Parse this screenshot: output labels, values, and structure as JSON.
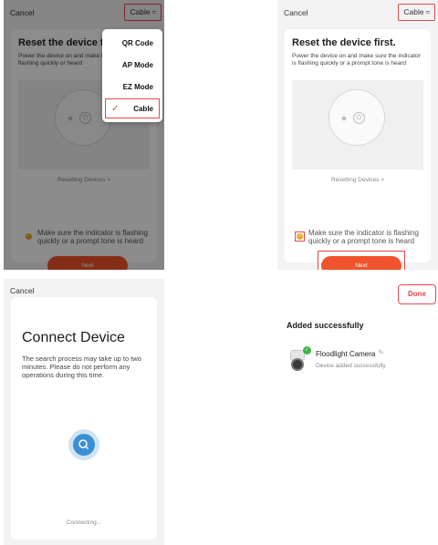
{
  "topbar": {
    "cancel_label": "Cancel",
    "cable_label": "Cable",
    "cable_icon": "≈"
  },
  "reset": {
    "title": "Reset the device first.",
    "title_truncated": "Reset the device firs",
    "description": "Power the device on and make sure the indicator is flashing quickly or a prompt tone is heard",
    "description_truncated": "Power the device on and make indicator is flashing quickly or heard",
    "resetting_link": "Resetting Devices",
    "resetting_chevron": ">",
    "checkbox_text": "Make sure the indicator is flashing quickly or a prompt tone is heard",
    "next_label": "Next"
  },
  "mode_menu": {
    "items": [
      {
        "label": "QR Code"
      },
      {
        "label": "AP Mode"
      },
      {
        "label": "EZ Mode"
      },
      {
        "label": "Cable",
        "selected": true
      }
    ],
    "tick_icon": "✓"
  },
  "connect": {
    "cancel_label": "Cancel",
    "title": "Connect Device",
    "description": "The search process may take up to two minutes. Please do not perform any operations during this time.",
    "status": "Connecting..."
  },
  "added": {
    "done_label": "Done",
    "title": "Added successfully",
    "device_name": "Floodlight Camera",
    "device_status": "Device added successfully",
    "edit_icon": "✎",
    "badge_icon": "✓"
  },
  "colors": {
    "accent": "#f0542c",
    "highlight": "#e5484d",
    "check": "#f0a524",
    "search": "#3d8fd4",
    "success": "#3bb54a"
  }
}
